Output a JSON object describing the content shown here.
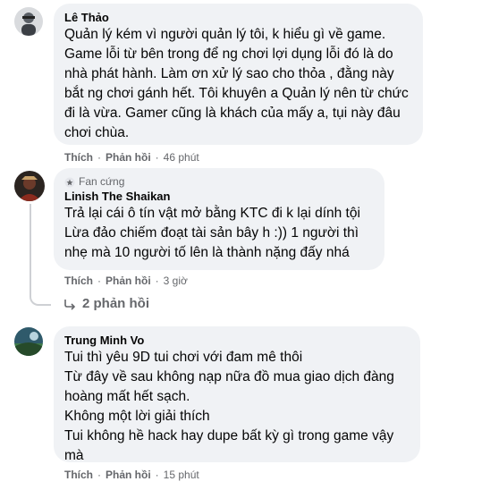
{
  "comments": [
    {
      "author": "Lê Thảo",
      "text": "Quản lý kém vì người quản lý tôi, k hiểu gì về game. Game lỗi từ bên trong để ng chơi lợi dụng lỗi đó là do nhà phát hành. Làm ơn xử lý sao cho thỏa , đằng này bắt ng chơi gánh hết. Tôi khuyên a Quản lý nên từ chức đi là vừa. Gamer cũng là khách của mấy a, tụi này đâu chơi chùa.",
      "like": "Thích",
      "reply": "Phản hồi",
      "time": "46 phút"
    },
    {
      "badge": "Fan cứng",
      "author": "Linish The Shaikan",
      "text": "Trả lại cái ô tín vật mở bằng KTC đi k lại dính tội Lừa đảo chiếm đoạt tài sản bây h :)) 1 người thì nhẹ mà 10 người tố lên là thành nặng đấy nhá",
      "like": "Thích",
      "reply": "Phản hồi",
      "time": "3 giờ",
      "replies_label": "2 phản hồi"
    },
    {
      "author": "Trung Minh Vo",
      "text_lines": [
        "Tui thì yêu 9D tui chơi với đam mê thôi",
        "Từ đây về sau không nạp nữa đồ mua giao dịch đàng hoàng mất hết sạch.",
        "Không một lời giải thích",
        "Tui không hề hack hay dupe bất kỳ gì trong game vậy mà"
      ],
      "like": "Thích",
      "reply": "Phản hồi",
      "time": "15 phút"
    }
  ],
  "dot": "·",
  "icons": {
    "fan_badge": "fan-badge-icon",
    "reply_arrow": "reply-arrow-icon"
  }
}
